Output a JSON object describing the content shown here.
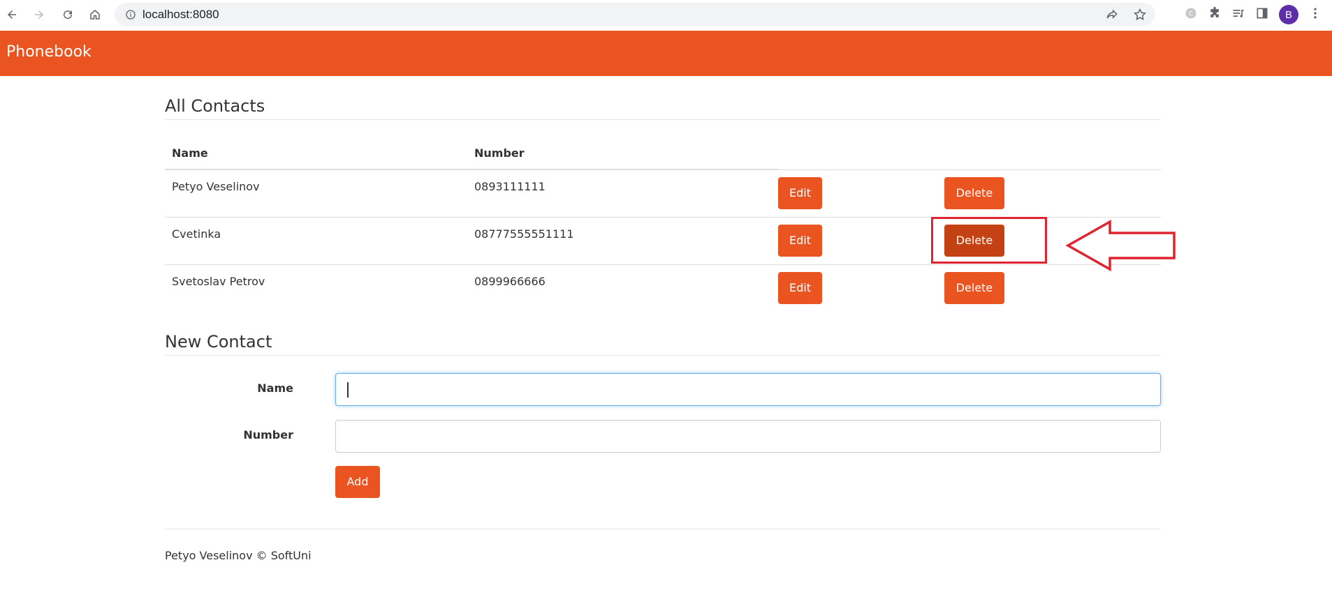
{
  "browser": {
    "url": "localhost:8080",
    "avatar_letter": "B"
  },
  "app": {
    "brand": "Phonebook",
    "accent_color": "#e95420",
    "active_button_color": "#c34113"
  },
  "contacts_section": {
    "title": "All Contacts",
    "columns": [
      "Name",
      "Number"
    ],
    "rows": [
      {
        "name": "Petyo Veselinov",
        "number": "0893111111",
        "edit_label": "Edit",
        "delete_label": "Delete"
      },
      {
        "name": "Cvetinka",
        "number": "08777555551111",
        "edit_label": "Edit",
        "delete_label": "Delete"
      },
      {
        "name": "Svetoslav Petrov",
        "number": "0899966666",
        "edit_label": "Edit",
        "delete_label": "Delete"
      }
    ]
  },
  "new_contact": {
    "title": "New Contact",
    "name_label": "Name",
    "number_label": "Number",
    "name_value": "",
    "number_value": "",
    "add_label": "Add"
  },
  "footer": {
    "text": "Petyo Veselinov © SoftUni"
  },
  "annotation": {
    "color": "#e0242f"
  }
}
